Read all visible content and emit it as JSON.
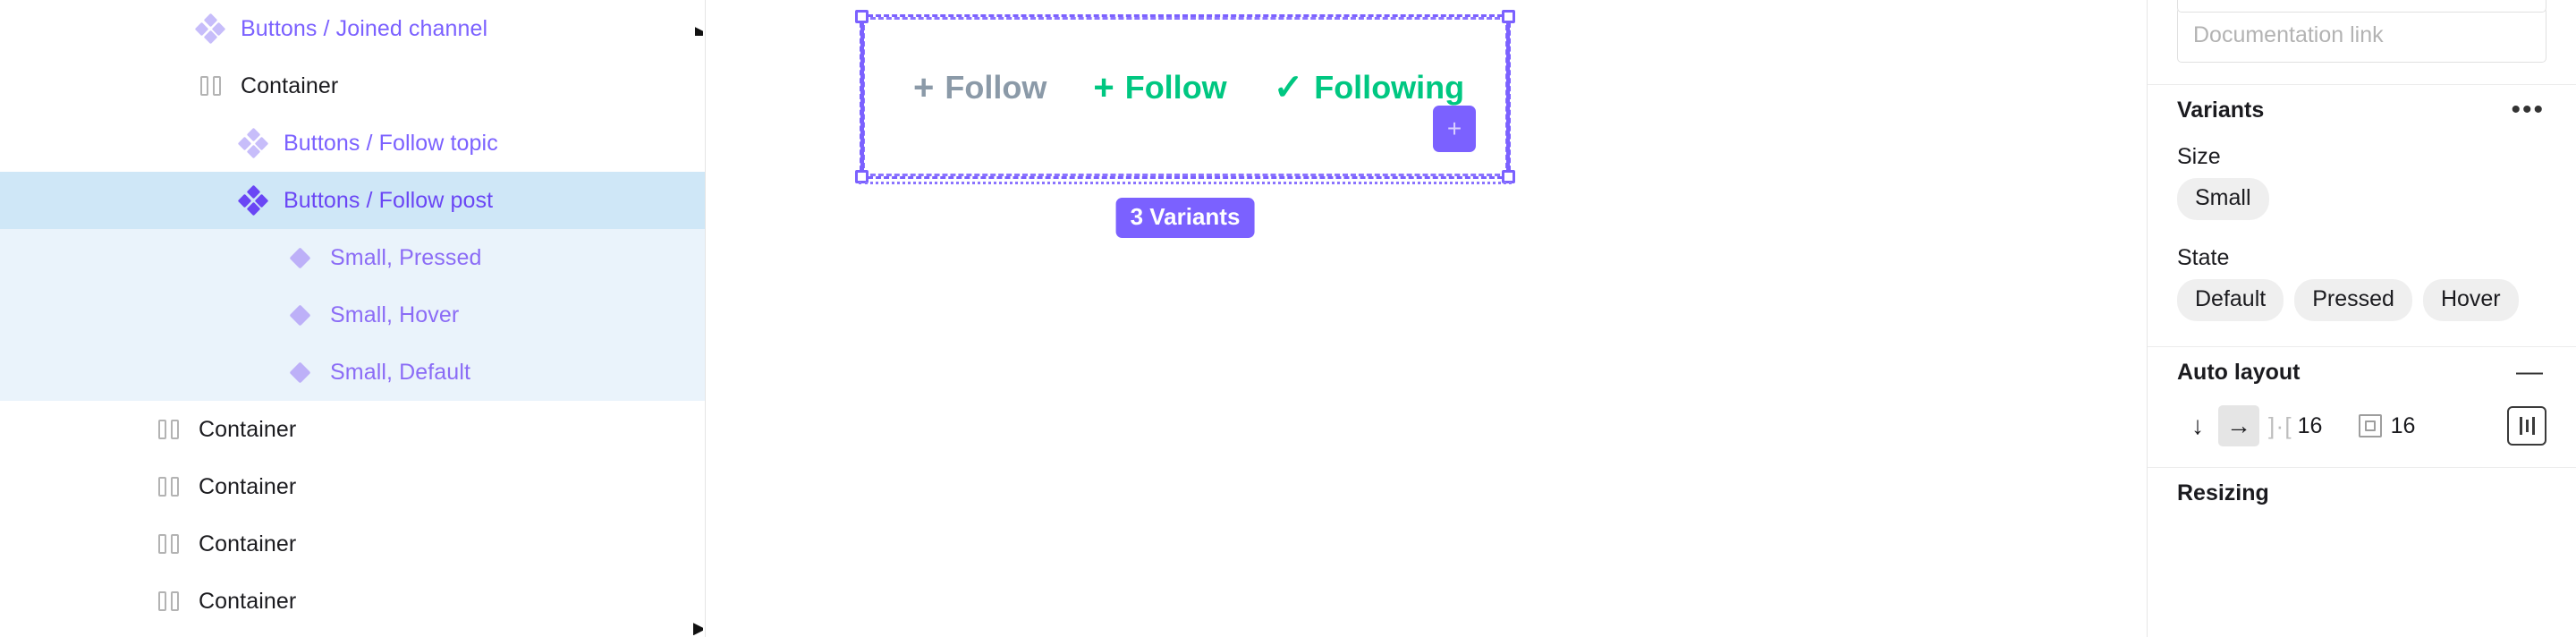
{
  "layers": {
    "rows": [
      {
        "label": "Buttons / Joined channel",
        "icon": "component-set-icon",
        "indent": 215,
        "kind": "component",
        "state": "normal"
      },
      {
        "label": "Container",
        "icon": "auto-layout-frame-icon",
        "indent": 215,
        "kind": "frame",
        "state": "normal"
      },
      {
        "label": "Buttons / Follow topic",
        "icon": "component-set-icon",
        "indent": 263,
        "kind": "component",
        "state": "normal"
      },
      {
        "label": "Buttons / Follow post",
        "icon": "component-set-icon",
        "indent": 263,
        "kind": "component",
        "state": "selected"
      },
      {
        "label": "Small, Pressed",
        "icon": "variant-diamond-icon",
        "indent": 315,
        "kind": "variant",
        "state": "child-selected"
      },
      {
        "label": "Small, Hover",
        "icon": "variant-diamond-icon",
        "indent": 315,
        "kind": "variant",
        "state": "child-selected"
      },
      {
        "label": "Small, Default",
        "icon": "variant-diamond-icon",
        "indent": 315,
        "kind": "variant",
        "state": "child-selected"
      },
      {
        "label": "Container",
        "icon": "auto-layout-frame-icon",
        "indent": 168,
        "kind": "frame",
        "state": "normal"
      },
      {
        "label": "Container",
        "icon": "auto-layout-frame-icon",
        "indent": 168,
        "kind": "frame",
        "state": "normal"
      },
      {
        "label": "Container",
        "icon": "auto-layout-frame-icon",
        "indent": 168,
        "kind": "frame",
        "state": "normal"
      },
      {
        "label": "Container",
        "icon": "auto-layout-frame-icon",
        "indent": 168,
        "kind": "frame",
        "state": "normal"
      }
    ]
  },
  "canvas": {
    "variants": [
      {
        "glyph": "+",
        "label": "Follow",
        "style": "pressed"
      },
      {
        "glyph": "+",
        "label": "Follow",
        "style": "default"
      },
      {
        "glyph": "✓",
        "label": "Following",
        "style": "hover"
      }
    ],
    "add_variant_glyph": "+",
    "badge_label": "3 Variants",
    "selection_color": "#7b61ff"
  },
  "properties": {
    "documentation_link_placeholder": "Documentation link",
    "variants": {
      "title": "Variants",
      "more_label": "•••",
      "size_label": "Size",
      "size_options": [
        "Small"
      ],
      "state_label": "State",
      "state_options": [
        "Default",
        "Pressed",
        "Hover"
      ]
    },
    "auto_layout": {
      "title": "Auto layout",
      "collapse_glyph": "—",
      "direction_vertical_glyph": "↓",
      "direction_horizontal_glyph": "→",
      "spacing_icon": "] · [",
      "spacing_value": "16",
      "padding_value": "16",
      "align_icon": "alignment-icon"
    },
    "resizing": {
      "title": "Resizing"
    }
  },
  "edge_glyph": "▸"
}
